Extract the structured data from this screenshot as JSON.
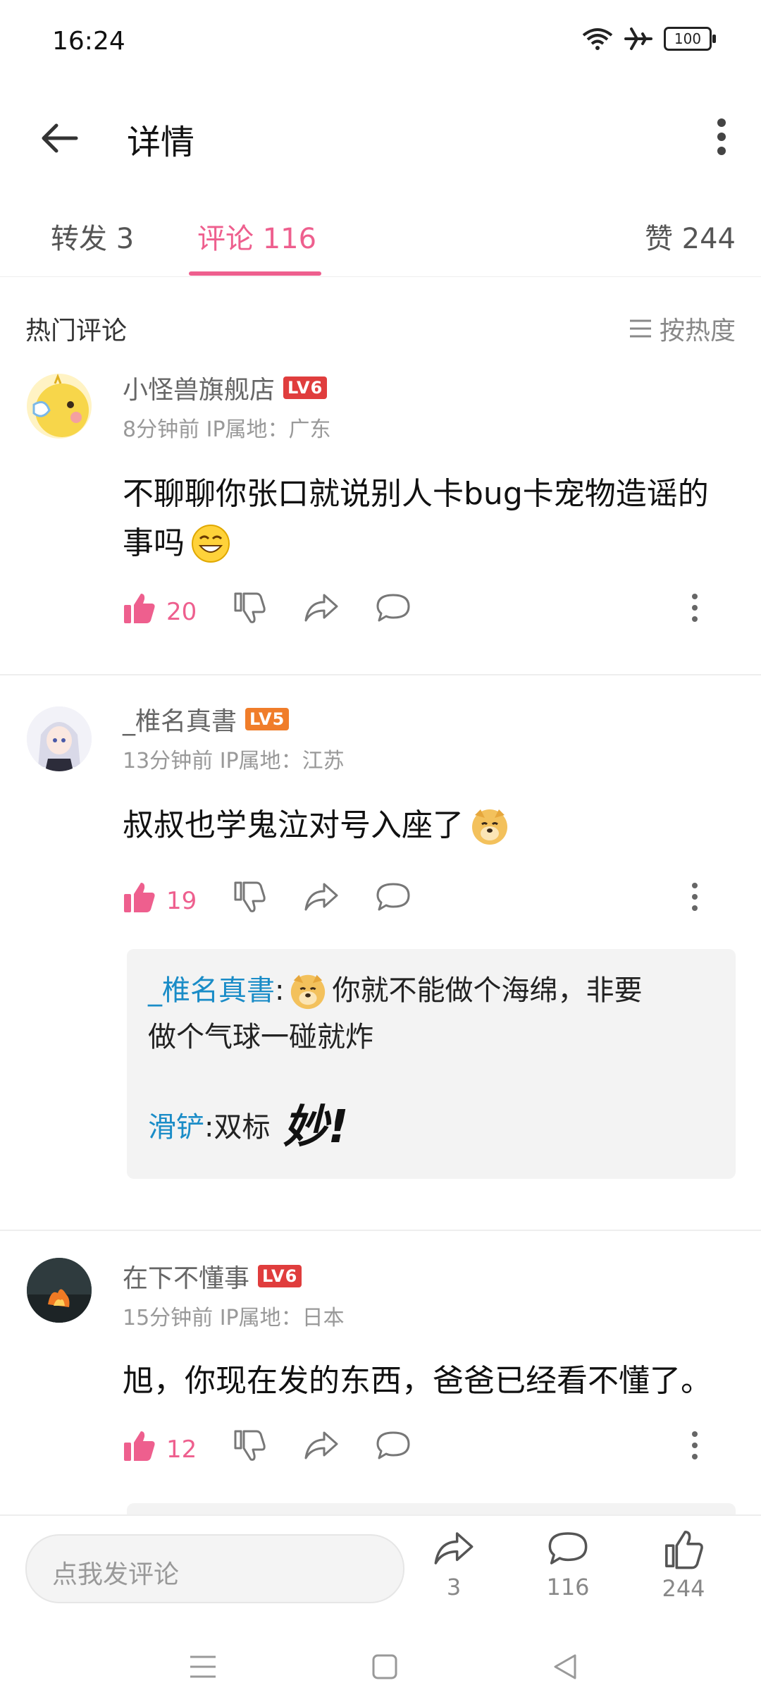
{
  "status_bar": {
    "time": "16:24",
    "battery": "100"
  },
  "header": {
    "title": "详情"
  },
  "tabs": {
    "forward": "转发 3",
    "comments": "评论 116",
    "likes": "赞 244"
  },
  "section": {
    "title": "热门评论",
    "sort_label": "按热度"
  },
  "comments": [
    {
      "user": "小怪兽旗舰店",
      "level": "LV6",
      "meta": "8分钟前  IP属地：广东",
      "text_line1": "不聊聊你张口就说别人卡bug卡宠物造谣的",
      "text_line2": "事吗",
      "likes": "20"
    },
    {
      "user": "_椎名真書",
      "level": "LV5",
      "meta": "13分钟前  IP属地：江苏",
      "text_line1": "叔叔也学鬼泣对号入座了",
      "likes": "19",
      "replies": [
        {
          "name": "_椎名真書",
          "sep": ": ",
          "text_a": "你就不能做个海绵，非要",
          "text_b": "做个气球一碰就炸"
        },
        {
          "name": "滑铲",
          "sep": ": ",
          "text_a": "双标",
          "sticker": "妙!"
        }
      ]
    },
    {
      "user": "在下不懂事",
      "level": "LV6",
      "meta": "15分钟前  IP属地：日本",
      "text_line1": "旭，你现在发的东西，爸爸已经看不懂了。",
      "likes": "12"
    }
  ],
  "bottom_bar": {
    "placeholder": "点我发评论",
    "share_count": "3",
    "comment_count": "116",
    "like_count": "244"
  },
  "colors": {
    "accent": "#ee5f8e",
    "link": "#1a8cc7"
  }
}
